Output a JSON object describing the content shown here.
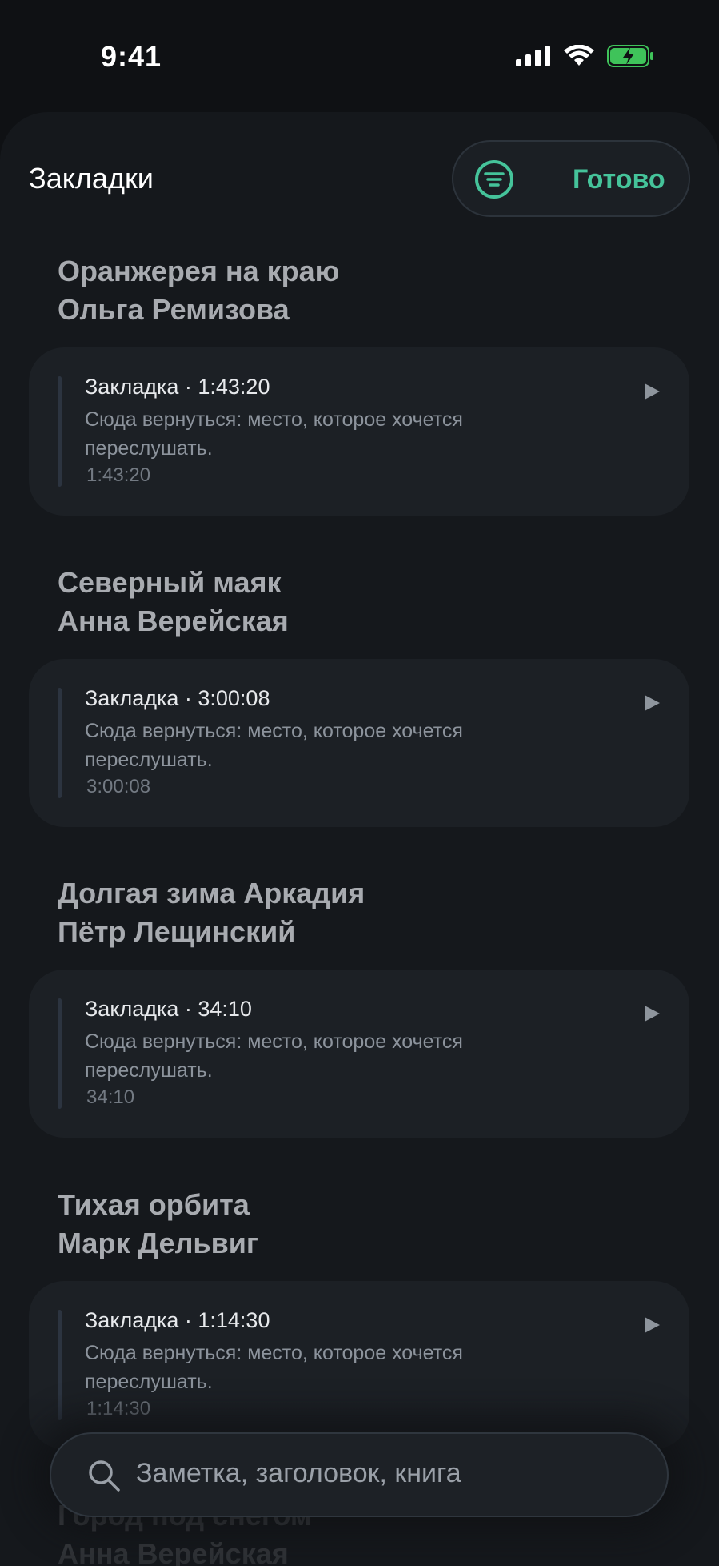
{
  "status": {
    "time": "9:41"
  },
  "header": {
    "title": "Закладки",
    "done_label": "Готово"
  },
  "bookmarks": [
    {
      "book": "Оранжерея на краю",
      "author": "Ольга Ремизова",
      "head": "Закладка · 1:43:20",
      "note": "Сюда вернуться: место, которое хочется переслушать.",
      "time": "1:43:20"
    },
    {
      "book": "Северный маяк",
      "author": "Анна Верейская",
      "head": "Закладка · 3:00:08",
      "note": "Сюда вернуться: место, которое хочется переслушать.",
      "time": "3:00:08"
    },
    {
      "book": "Долгая зима Аркадия",
      "author": "Пётр Лещинский",
      "head": "Закладка · 34:10",
      "note": "Сюда вернуться: место, которое хочется переслушать.",
      "time": "34:10"
    },
    {
      "book": "Тихая орбита",
      "author": "Марк Дельвиг",
      "head": "Закладка · 1:14:30",
      "note": "Сюда вернуться: место, которое хочется переслушать.",
      "time": "1:14:30"
    },
    {
      "book": "Город под снегом",
      "author": "Анна Верейская"
    }
  ],
  "search": {
    "placeholder": "Заметка, заголовок, книга"
  },
  "colors": {
    "accent": "#45c39a",
    "background": "#15181c",
    "card": "#1c2025"
  }
}
